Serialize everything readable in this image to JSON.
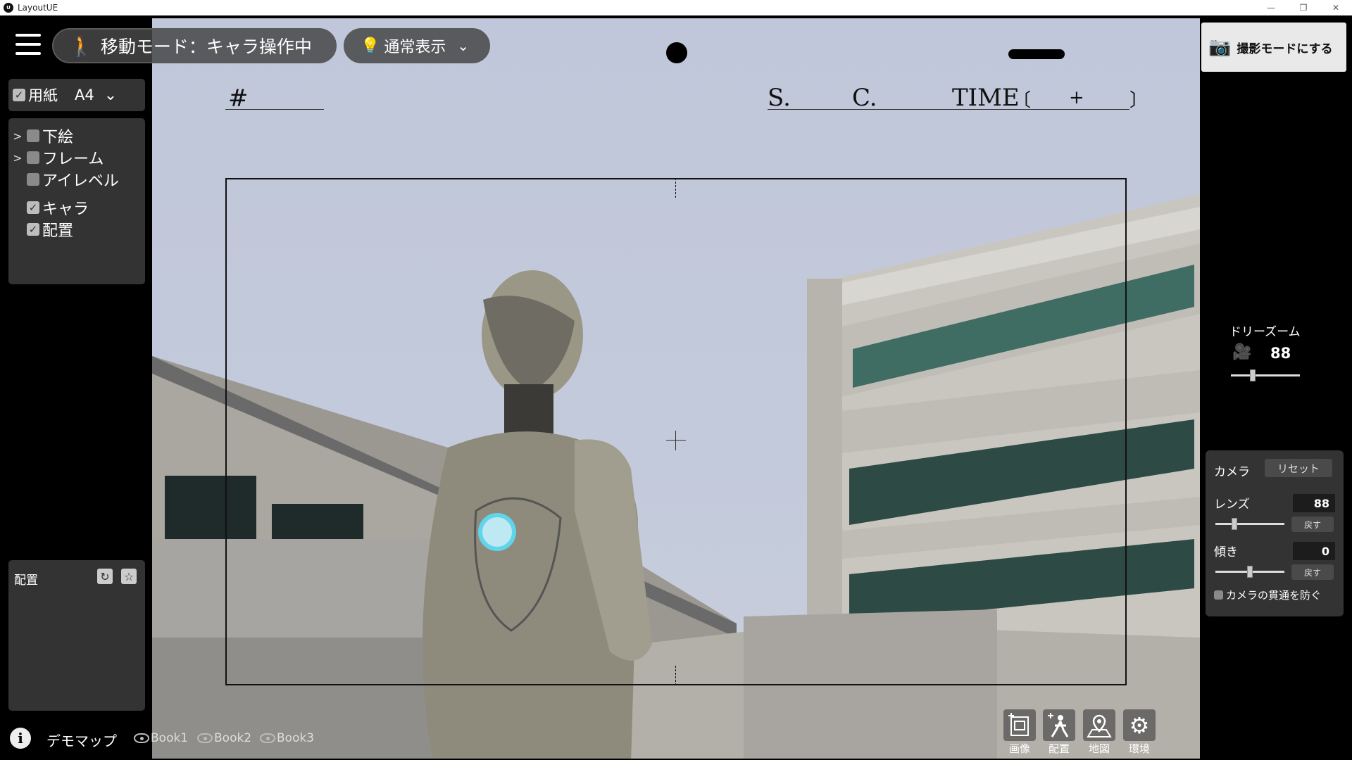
{
  "window": {
    "title": "LayoutUE"
  },
  "toolbar": {
    "mode_label": "移動モード：キャラ操作中",
    "view_label": "通常表示"
  },
  "paper": {
    "label": "用紙",
    "size": "A4",
    "checked": true,
    "header": {
      "cut": "#",
      "scene": "S.",
      "cut_no": "C.",
      "time": "TIME",
      "time_bracket_open": "〔",
      "time_plus": "+",
      "time_bracket_close": "〕"
    }
  },
  "layers": [
    {
      "label": "下絵",
      "checked": false,
      "expandable": true
    },
    {
      "label": "フレーム",
      "checked": false,
      "expandable": true
    },
    {
      "label": "アイレベル",
      "checked": false,
      "expandable": false
    },
    {
      "label": "キャラ",
      "checked": true,
      "expandable": false
    },
    {
      "label": "配置",
      "checked": true,
      "expandable": false
    }
  ],
  "placement_panel": {
    "title": "配置"
  },
  "footer": {
    "map_name": "デモマップ",
    "books": [
      "Book1",
      "Book2",
      "Book3"
    ]
  },
  "tools": [
    {
      "label": "画像",
      "icon": "image-add-icon"
    },
    {
      "label": "配置",
      "icon": "character-add-icon"
    },
    {
      "label": "地図",
      "icon": "map-icon"
    },
    {
      "label": "環境",
      "icon": "gear-icon"
    }
  ],
  "shoot_button": {
    "label": "撮影モードにする"
  },
  "dolly": {
    "title": "ドリーズーム",
    "value": "88",
    "level": 0.3
  },
  "camera": {
    "title": "カメラ",
    "reset_label": "リセット",
    "lens_label": "レンズ",
    "lens_value": "88",
    "lens_level": 0.25,
    "tilt_label": "傾き",
    "tilt_value": "0",
    "tilt_level": 0.5,
    "back_label": "戻す",
    "penetration_label": "カメラの貫通を防ぐ",
    "penetration_checked": false
  }
}
